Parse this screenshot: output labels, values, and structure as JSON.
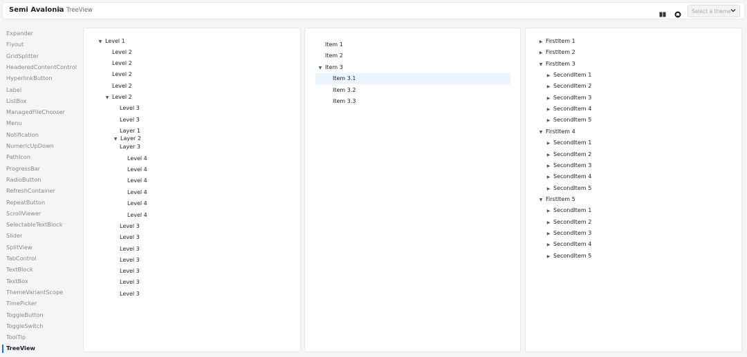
{
  "header": {
    "app_title": "Semi Avalonia",
    "separator": "/",
    "page": "TreeView",
    "icons": [
      "book-icon",
      "github-icon"
    ],
    "theme_select": {
      "placeholder": "Select a theme"
    }
  },
  "sidebar": {
    "items": [
      "Expander",
      "Flyout",
      "GridSplitter",
      "HeaderedContentControl",
      "HyperlinkButton",
      "Label",
      "ListBox",
      "ManagedFileChooser",
      "Menu",
      "Notification",
      "NumericUpDown",
      "PathIcon",
      "ProgressBar",
      "RadioButton",
      "RefreshContainer",
      "RepeatButton",
      "ScrollViewer",
      "SelectableTextBlock",
      "Slider",
      "SplitView",
      "TabControl",
      "TextBlock",
      "TextBox",
      "ThemeVariantScope",
      "TimePicker",
      "ToggleButton",
      "ToggleSwitch",
      "ToolTip",
      "TreeView"
    ],
    "active": "TreeView"
  },
  "tree1": [
    {
      "label": "Level 1",
      "expanded": true
    },
    {
      "label": "Level 2"
    },
    {
      "label": "Level 2"
    },
    {
      "label": "Level 2"
    },
    {
      "label": "Level 2"
    },
    {
      "label": "Level 2",
      "expanded": true
    },
    {
      "label": "Level 3"
    },
    {
      "label": "Level 3"
    },
    {
      "label": "Layer 1"
    },
    {
      "label": "Layer 2",
      "expanded": true
    },
    {
      "label": "Layer 3"
    },
    {
      "label": "Level 4"
    },
    {
      "label": "Level 4"
    },
    {
      "label": "Level 4"
    },
    {
      "label": "Level 4"
    },
    {
      "label": "Level 4"
    },
    {
      "label": "Level 4"
    },
    {
      "label": "Level 3"
    },
    {
      "label": "Level 3"
    },
    {
      "label": "Level 3"
    },
    {
      "label": "Level 3"
    },
    {
      "label": "Level 3"
    },
    {
      "label": "Level 3"
    },
    {
      "label": "Level 3"
    }
  ],
  "tree2": [
    {
      "label": "Item 1"
    },
    {
      "label": "Item 2"
    },
    {
      "label": "Item 3",
      "expanded": true
    },
    {
      "label": "Item 3.1",
      "selected": true
    },
    {
      "label": "Item 3.2"
    },
    {
      "label": "Item 3.3"
    }
  ],
  "tree3": [
    {
      "label": "FirstItem 1",
      "expanded": false
    },
    {
      "label": "FirstItem 2",
      "expanded": false
    },
    {
      "label": "FirstItem 3",
      "expanded": true
    },
    {
      "label": "SecondItem 1",
      "expanded": false
    },
    {
      "label": "SecondItem 2",
      "expanded": false
    },
    {
      "label": "SecondItem 3",
      "expanded": false
    },
    {
      "label": "SecondItem 4",
      "expanded": false
    },
    {
      "label": "SecondItem 5",
      "expanded": false
    },
    {
      "label": "FirstItem 4",
      "expanded": true
    },
    {
      "label": "SecondItem 1",
      "expanded": false
    },
    {
      "label": "SecondItem 2",
      "expanded": false
    },
    {
      "label": "SecondItem 3",
      "expanded": false
    },
    {
      "label": "SecondItem 4",
      "expanded": false
    },
    {
      "label": "SecondItem 5",
      "expanded": false
    },
    {
      "label": "FirstItem 5",
      "expanded": true
    },
    {
      "label": "SecondItem 1",
      "expanded": false
    },
    {
      "label": "SecondItem 2",
      "expanded": false
    },
    {
      "label": "SecondItem 3",
      "expanded": false
    },
    {
      "label": "SecondItem 4",
      "expanded": false
    },
    {
      "label": "SecondItem 5",
      "expanded": false
    }
  ],
  "colors": {
    "accent": "#0077fa",
    "selection": "#eaf5ff",
    "text_muted": "#888888"
  }
}
